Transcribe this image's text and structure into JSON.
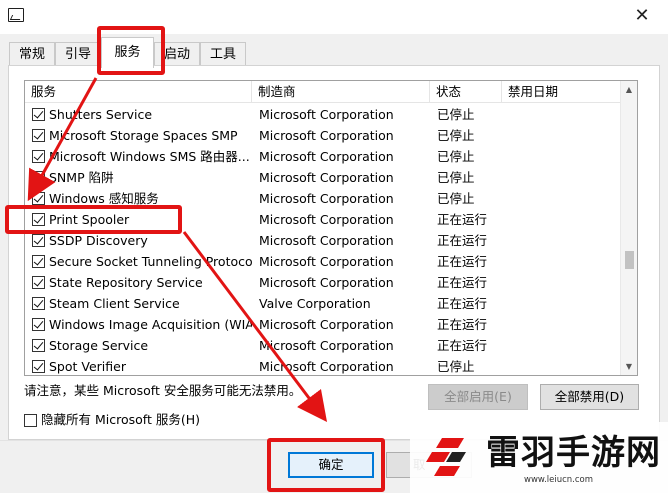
{
  "tabs": [
    {
      "label": "常规",
      "active": false
    },
    {
      "label": "引导",
      "active": false
    },
    {
      "label": "服务",
      "active": true
    },
    {
      "label": "启动",
      "active": false
    },
    {
      "label": "工具",
      "active": false
    }
  ],
  "columns": [
    "服务",
    "制造商",
    "状态",
    "禁用日期"
  ],
  "services": [
    {
      "name": "Shutters Service",
      "manufacturer": "Microsoft Corporation",
      "status": "已停止",
      "checked": true
    },
    {
      "name": "Microsoft Storage Spaces SMP",
      "manufacturer": "Microsoft Corporation",
      "status": "已停止",
      "checked": true
    },
    {
      "name": "Microsoft Windows SMS 路由器...",
      "manufacturer": "Microsoft Corporation",
      "status": "已停止",
      "checked": true
    },
    {
      "name": "SNMP 陷阱",
      "manufacturer": "Microsoft Corporation",
      "status": "已停止",
      "checked": true
    },
    {
      "name": "Windows 感知服务",
      "manufacturer": "Microsoft Corporation",
      "status": "已停止",
      "checked": true
    },
    {
      "name": "Print Spooler",
      "manufacturer": "Microsoft Corporation",
      "status": "正在运行",
      "checked": true
    },
    {
      "name": "SSDP Discovery",
      "manufacturer": "Microsoft Corporation",
      "status": "正在运行",
      "checked": true
    },
    {
      "name": "Secure Socket Tunneling Protoco...",
      "manufacturer": "Microsoft Corporation",
      "status": "正在运行",
      "checked": true
    },
    {
      "name": "State Repository Service",
      "manufacturer": "Microsoft Corporation",
      "status": "正在运行",
      "checked": true
    },
    {
      "name": "Steam Client Service",
      "manufacturer": "Valve Corporation",
      "status": "正在运行",
      "checked": true
    },
    {
      "name": "Windows Image Acquisition (WIA)",
      "manufacturer": "Microsoft Corporation",
      "status": "正在运行",
      "checked": true
    },
    {
      "name": "Storage Service",
      "manufacturer": "Microsoft Corporation",
      "status": "正在运行",
      "checked": true
    },
    {
      "name": "Spot Verifier",
      "manufacturer": "Microsoft Corporation",
      "status": "已停止",
      "checked": true
    }
  ],
  "notice": "请注意，某些 Microsoft 安全服务可能无法禁用。",
  "buttons": {
    "enable_all": "全部启用(E)",
    "disable_all": "全部禁用(D)",
    "ok": "确定",
    "cancel_partial": "取"
  },
  "hide_ms_label": "隐藏所有 Microsoft 服务(H)",
  "hide_ms_checked": false,
  "icons": {
    "close": "✕",
    "scroll_up": "▲",
    "scroll_down": "▼"
  },
  "watermark": {
    "name": "雷羽手游网",
    "url": "www.leiucn.com"
  },
  "colors": {
    "highlight": "#e21414",
    "accent": "#0078d7"
  }
}
